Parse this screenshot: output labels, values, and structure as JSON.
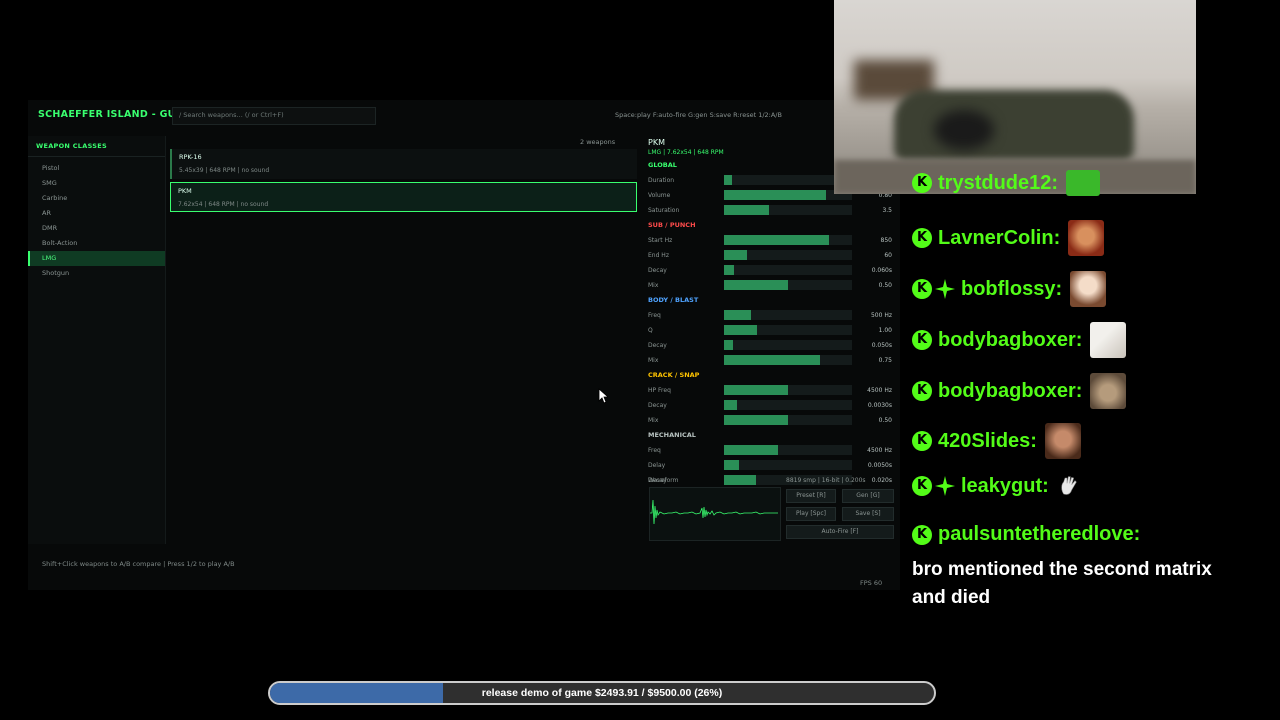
{
  "app": {
    "title": "SCHAEFFER ISLAND - GUNS",
    "search_placeholder": "/ Search weapons... (/ or Ctrl+F)",
    "hotkeys": "Space:play  F:auto-fire  G:gen  S:save  R:reset  1/2:A/B",
    "footer_hint": "Shift+Click weapons to A/B compare  |  Press 1/2 to play A/B",
    "fps": "FPS 60"
  },
  "sidebar": {
    "header": "WEAPON CLASSES",
    "items": [
      {
        "label": "Pistol",
        "active": false
      },
      {
        "label": "SMG",
        "active": false
      },
      {
        "label": "Carbine",
        "active": false
      },
      {
        "label": "AR",
        "active": false
      },
      {
        "label": "DMR",
        "active": false
      },
      {
        "label": "Bolt-Action",
        "active": false
      },
      {
        "label": "LMG",
        "active": true
      },
      {
        "label": "Shotgun",
        "active": false
      }
    ]
  },
  "weapons": {
    "count": "2 weapons",
    "items": [
      {
        "name": "RPK-16",
        "meta": "5.45x39  |  648 RPM  |  no sound",
        "selected": false
      },
      {
        "name": "PKM",
        "meta": "7.62x54  |  648 RPM  |  no sound",
        "selected": true
      }
    ]
  },
  "panel": {
    "title": "PKM",
    "subtitle": "LMG  |  7.62x54  |  648 RPM",
    "sections": [
      {
        "name": "GLOBAL",
        "color": "#39ff6f",
        "params": [
          {
            "label": "Duration",
            "value": "",
            "level": 0.06
          },
          {
            "label": "Volume",
            "value": "0.80",
            "level": 0.8
          },
          {
            "label": "Saturation",
            "value": "3.5",
            "level": 0.35
          }
        ]
      },
      {
        "name": "SUB / PUNCH",
        "color": "#ff4b4b",
        "params": [
          {
            "label": "Start Hz",
            "value": "850",
            "level": 0.82
          },
          {
            "label": "End Hz",
            "value": "60",
            "level": 0.18
          },
          {
            "label": "Decay",
            "value": "0.060s",
            "level": 0.08
          },
          {
            "label": "Mix",
            "value": "0.50",
            "level": 0.5
          }
        ]
      },
      {
        "name": "BODY / BLAST",
        "color": "#4fa3ff",
        "params": [
          {
            "label": "Freq",
            "value": "500 Hz",
            "level": 0.21
          },
          {
            "label": "Q",
            "value": "1.00",
            "level": 0.26
          },
          {
            "label": "Decay",
            "value": "0.050s",
            "level": 0.07
          },
          {
            "label": "Mix",
            "value": "0.75",
            "level": 0.75
          }
        ]
      },
      {
        "name": "CRACK / SNAP",
        "color": "#ffc400",
        "params": [
          {
            "label": "HP Freq",
            "value": "4500 Hz",
            "level": 0.5
          },
          {
            "label": "Decay",
            "value": "0.0030s",
            "level": 0.1
          },
          {
            "label": "Mix",
            "value": "0.50",
            "level": 0.5
          }
        ]
      },
      {
        "name": "MECHANICAL",
        "color": "#b9c4c2",
        "params": [
          {
            "label": "Freq",
            "value": "4500 Hz",
            "level": 0.42
          },
          {
            "label": "Delay",
            "value": "0.0050s",
            "level": 0.12
          },
          {
            "label": "Decay",
            "value": "0.020s",
            "level": 0.25
          }
        ]
      }
    ],
    "waveform_label": "Waveform",
    "sample_info": "8819 smp | 16-bit | 0.200s",
    "buttons": {
      "preset": "Preset [R]",
      "gen": "Gen [G]",
      "play": "Play [Spc]",
      "save": "Save [S]",
      "autofire": "Auto-Fire [F]"
    }
  },
  "chat": {
    "messages": [
      {
        "user": "trystdude12:",
        "badge": "kick"
      },
      {
        "user": "LavnerColin:",
        "badge": "kick"
      },
      {
        "user": "bobflossy:",
        "badge": "kick+spark"
      },
      {
        "user": "bodybagboxer:",
        "badge": "kick"
      },
      {
        "user": "bodybagboxer:",
        "badge": "kick"
      },
      {
        "user": "420Slides:",
        "badge": "kick"
      },
      {
        "user": "leakygut:",
        "badge": "kick+spark"
      },
      {
        "user": "paulsuntetheredlove:",
        "badge": "kick"
      }
    ],
    "last_text": "bro mentioned the second matrix and died"
  },
  "goal": {
    "text": "release demo of game $2493.91 / $9500.00 (26%)",
    "progress": 0.26,
    "fill_color": "#3d6aa8"
  }
}
